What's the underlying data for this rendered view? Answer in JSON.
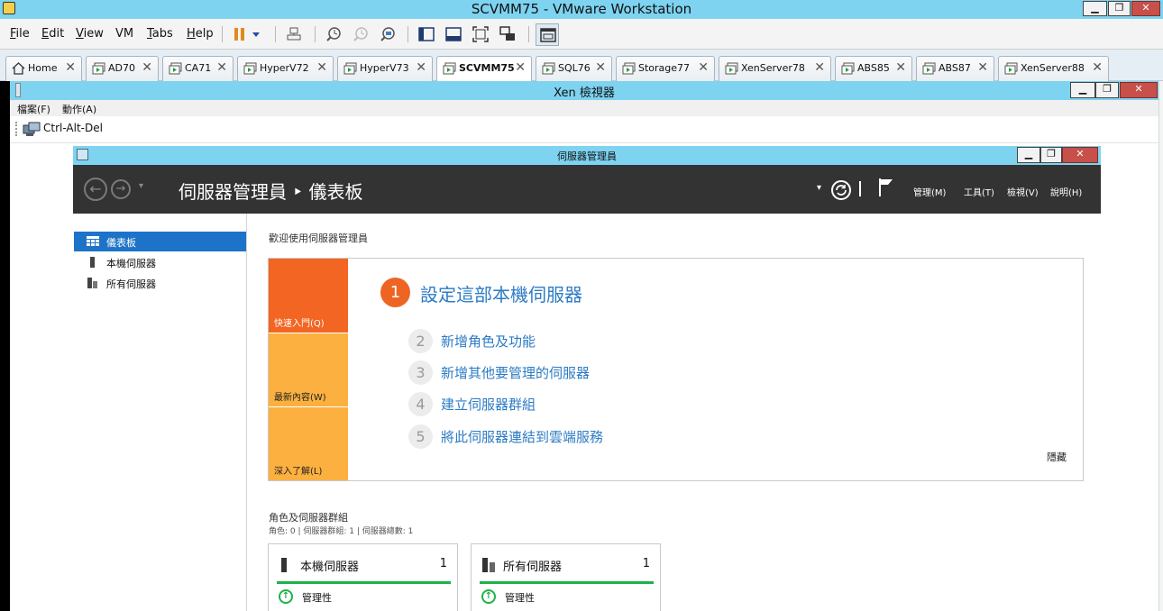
{
  "vmware": {
    "title": "SCVMM75 - VMware Workstation",
    "window_controls": {
      "minimize": "▁",
      "restore": "❐",
      "close": "✕"
    },
    "menu": [
      {
        "key": "F",
        "rest": "ile"
      },
      {
        "key": "E",
        "rest": "dit"
      },
      {
        "key": "V",
        "rest": "iew"
      },
      {
        "key": "",
        "rest": "VM"
      },
      {
        "key": "T",
        "rest": "abs"
      },
      {
        "key": "H",
        "rest": "elp"
      }
    ],
    "tabs": [
      {
        "label": "Home",
        "active": false
      },
      {
        "label": "AD70",
        "active": false
      },
      {
        "label": "CA71",
        "active": false
      },
      {
        "label": "HyperV72",
        "active": false
      },
      {
        "label": "HyperV73",
        "active": false
      },
      {
        "label": "SCVMM75",
        "active": true
      },
      {
        "label": "SQL76",
        "active": false
      },
      {
        "label": "Storage77",
        "active": false
      },
      {
        "label": "XenServer78",
        "active": false
      },
      {
        "label": "ABS85",
        "active": false
      },
      {
        "label": "ABS87",
        "active": false
      },
      {
        "label": "XenServer88",
        "active": false
      }
    ],
    "tab_close_glyph": "✕"
  },
  "xen": {
    "title": "Xen 檢視器",
    "menu": {
      "file": "檔案(F)",
      "action": "動作(A)"
    },
    "toolbar": {
      "ctrl_alt_del": "Ctrl-Alt-Del"
    }
  },
  "server_manager": {
    "window_title": "伺服器管理員",
    "breadcrumb": "伺服器管理員 ‣ 儀表板",
    "header_menu": {
      "manage": "管理(M)",
      "tools": "工具(T)",
      "view": "檢視(V)",
      "help": "說明(H)"
    },
    "sidebar": [
      {
        "label": "儀表板",
        "active": true,
        "icon": "dashboard-icon"
      },
      {
        "label": "本機伺服器",
        "active": false,
        "icon": "local-server-icon"
      },
      {
        "label": "所有伺服器",
        "active": false,
        "icon": "all-servers-icon"
      }
    ],
    "welcome": "歡迎使用伺服器管理員",
    "quickstart": {
      "blocks": [
        {
          "label": "快速入門(Q)",
          "color": "#f26522"
        },
        {
          "label": "最新內容(W)",
          "color": "#fbb040"
        },
        {
          "label": "深入了解(L)",
          "color": "#fbb040"
        }
      ],
      "main_step": {
        "num": "1",
        "text": "設定這部本機伺服器"
      },
      "steps": [
        {
          "num": "2",
          "text": "新增角色及功能"
        },
        {
          "num": "3",
          "text": "新增其他要管理的伺服器"
        },
        {
          "num": "4",
          "text": "建立伺服器群組"
        },
        {
          "num": "5",
          "text": "將此伺服器連結到雲端服務"
        }
      ],
      "hide": "隱藏"
    },
    "roles": {
      "title": "角色及伺服器群組",
      "summary": "角色: 0 | 伺服器群組: 1 | 伺服器總數: 1",
      "tiles": [
        {
          "name": "本機伺服器",
          "count": "1",
          "status": "管理性"
        },
        {
          "name": "所有伺服器",
          "count": "1",
          "status": "管理性"
        }
      ]
    }
  }
}
